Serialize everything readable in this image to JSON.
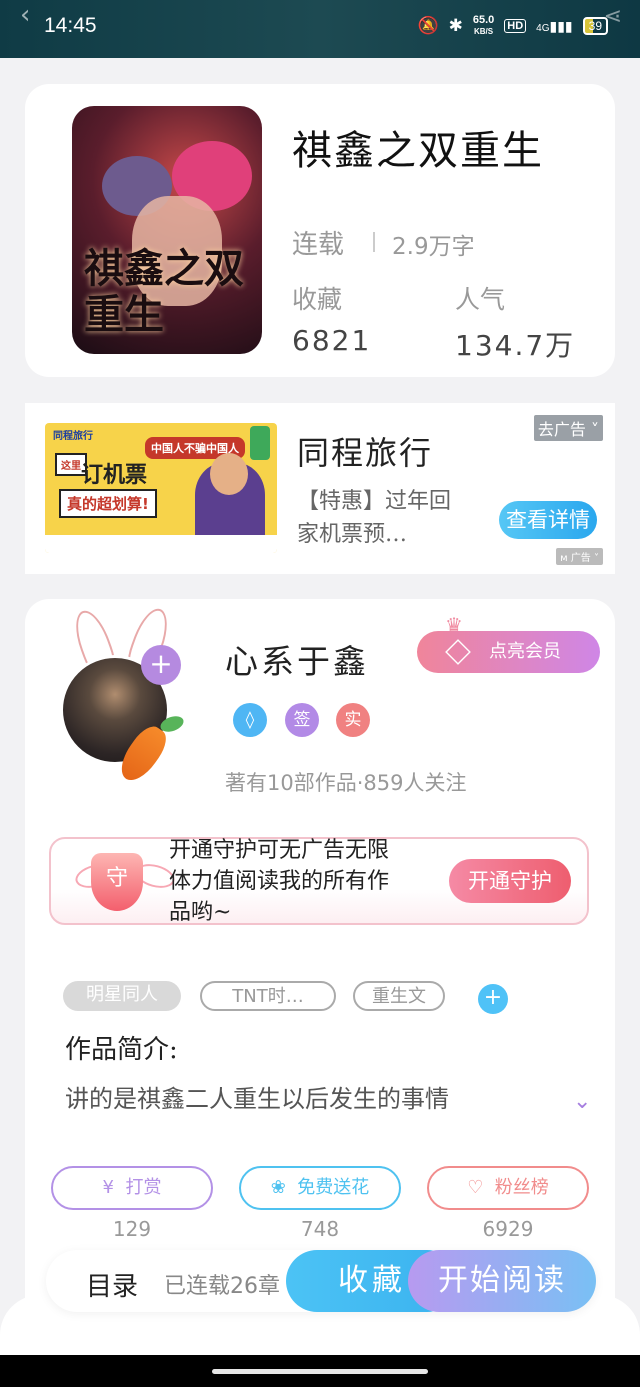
{
  "status_bar": {
    "time": "14:45",
    "speed_top": "65.0",
    "speed_bottom": "KB/S",
    "hd": "HD",
    "network": "4G",
    "battery": "39"
  },
  "book": {
    "cover_title": "祺鑫之双重生",
    "title": "祺鑫之双重生",
    "status": "连载",
    "words": "2.9万字",
    "favorites_label": "收藏",
    "favorites_value": "6821",
    "popularity_label": "人气",
    "popularity_value": "134.7万"
  },
  "ad": {
    "image_logo": "同程旅行",
    "image_bubble": "中国人不骗中国人",
    "image_here": "这里",
    "image_headline": "订机票",
    "image_sub": "真的超划算!",
    "title": "同程旅行",
    "description": "【特惠】过年回家机票预…",
    "close_label": "去广告",
    "detail_button": "查看详情",
    "tag_label": "广告"
  },
  "author": {
    "name": "心系于鑫",
    "vip_button": "点亮会员",
    "badges": [
      {
        "label": "◊",
        "color": "#4fb6f4"
      },
      {
        "label": "签",
        "color": "#b28ae6"
      },
      {
        "label": "实",
        "color": "#f08181"
      }
    ],
    "meta": "著有10部作品·859人关注"
  },
  "guard": {
    "icon_label": "守",
    "text": "开通守护可无广告无限体力值阅读我的所有作品哟~",
    "button": "开通守护"
  },
  "tags": [
    {
      "label": "明星同人"
    },
    {
      "label": "TNT时…"
    },
    {
      "label": "重生文"
    }
  ],
  "intro": {
    "label": "作品简介:",
    "text": "讲的是祺鑫二人重生以后发生的事情"
  },
  "actions": [
    {
      "icon": "¥",
      "label": "打赏",
      "count": "129",
      "color": "#b391e6"
    },
    {
      "icon": "❀",
      "label": "免费送花",
      "count": "748",
      "color": "#4fc2f0"
    },
    {
      "icon": "♡",
      "label": "粉丝榜",
      "count": "6929",
      "color": "#f18c8c"
    }
  ],
  "bottom": {
    "toc_label": "目录",
    "toc_info": "已连载26章",
    "collect_button": "收藏",
    "read_button": "开始阅读"
  },
  "colors": {
    "accent_blue": "#3ab2ef",
    "accent_purple": "#b79af0",
    "accent_pink": "#ee5e6f"
  }
}
